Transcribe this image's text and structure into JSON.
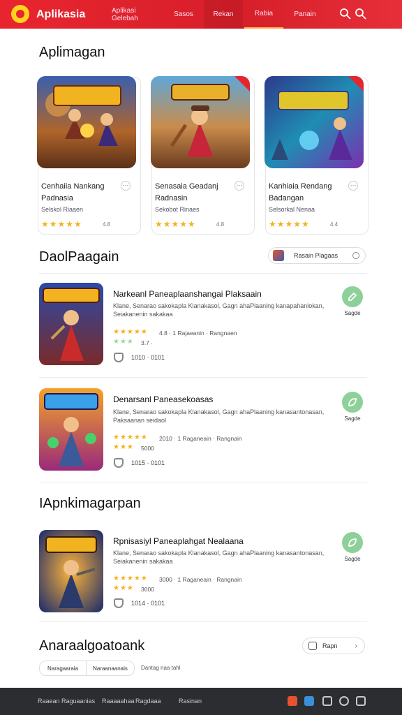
{
  "header": {
    "brand": "Aplikasia",
    "nav": [
      "Aplikasi Gelebah",
      "Sasos",
      "Rekan",
      "Rabia",
      "Panain"
    ],
    "icons": [
      "search-icon",
      "search-icon-2"
    ],
    "accent": "#e8252f"
  },
  "featured": {
    "title": "Aplimagan",
    "cards": [
      {
        "title": "Cenhaiia Nankang Padnasia",
        "sub": "Selskol Riaaen",
        "rating": "4.8"
      },
      {
        "title": "Senasaia Geadanj Radnasin",
        "sub": "Sekobot Rinaes",
        "rating": "4.8"
      },
      {
        "title": "Kanhiaia Rendang Badangan",
        "sub": "Selsorkal Nenaa",
        "rating": "4.4"
      }
    ]
  },
  "popular": {
    "title": "DaolPaagain",
    "pill_label": "Rasain Plagaas",
    "rows": [
      {
        "title": "Narkeanl Paneaplaanshangai Plaksaain",
        "desc": "Klane, Senarao sakokapla Klanakasol, Gagn ahaPlaaning kanapahanlokan, Seiakanenin sakakaa",
        "meta": "4.8 · 1 Rajaeanin · Rangnaen",
        "rating_sub": "3.7 ·",
        "size": "1010 · 0101",
        "get": "Sagde"
      },
      {
        "title": "Denarsanl Paneasekoasas",
        "desc": "Klane, Senarao sakokapla Klanakasol, Gagn ahaPlaaning kanasantonasan, Paksaanan seidaol",
        "meta": "2010 · 1 Raganeain · Rangnain",
        "rating_sub": "5000",
        "size": "1015 · 0101",
        "get": "Sagde"
      }
    ]
  },
  "more": {
    "title": "IApnkimagarpan",
    "rows": [
      {
        "title": "Rpnisasiyl Paneaplahgat Nealaana",
        "desc": "Klane, Senarao sakokapla Klanakasol, Gagn ahaPlaaning kanasantonasan, Seiakanenin sakakaa",
        "meta": "3000 · 1 Raganeain · Rangnain",
        "rating_sub": "3000",
        "size": "1014 · 0101",
        "get": "Sagde"
      }
    ]
  },
  "bottom": {
    "title": "Anaraalgoatoank",
    "pill_label": "Rapn",
    "tabs": [
      "Naragaaraia",
      "Naraanaanais"
    ],
    "tab_extra": "Dantag naa tahl"
  },
  "footer": {
    "links": [
      "Raaean Raguaanias",
      "Raaaaahaa",
      "Ragdaaa",
      "Rasinan"
    ],
    "icons": [
      "fire-icon",
      "share-icon",
      "doc-icon",
      "search-icon",
      "save-icon"
    ]
  }
}
